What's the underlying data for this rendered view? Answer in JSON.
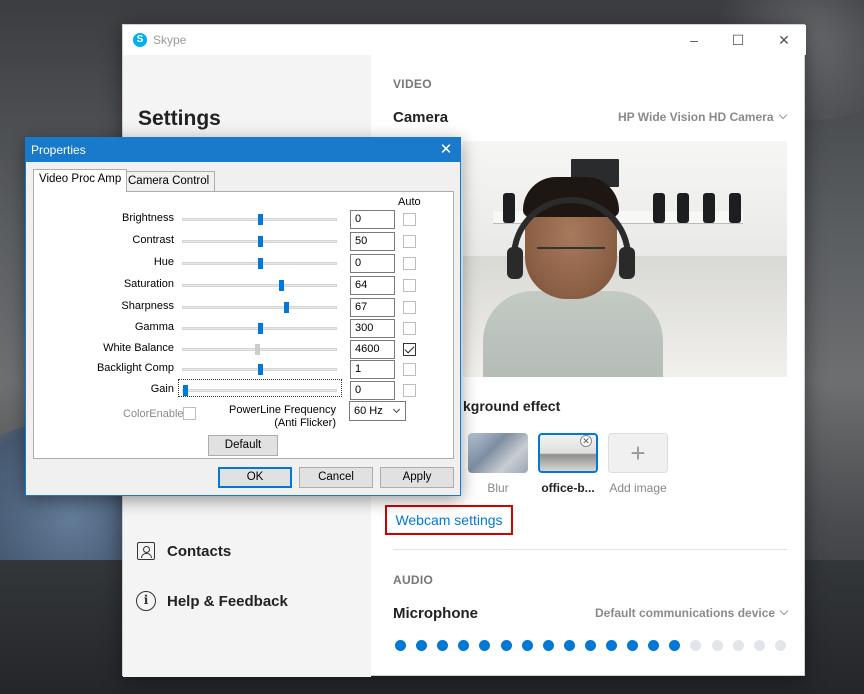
{
  "skype": {
    "title": "Skype",
    "settings_title": "Settings",
    "nav": [
      {
        "label": "Contacts",
        "icon": "contacts-icon"
      },
      {
        "label": "Help & Feedback",
        "icon": "help-icon"
      }
    ],
    "video": {
      "section_label": "VIDEO",
      "camera_label": "Camera",
      "camera_value": "HP Wide Vision HD Camera",
      "background_effect_label": "kground effect",
      "thumbnails": [
        {
          "caption": "Blur",
          "selected": false
        },
        {
          "caption": "office-b...",
          "selected": true
        },
        {
          "caption": "Add image",
          "selected": false
        }
      ],
      "webcam_settings_label": "Webcam settings"
    },
    "audio": {
      "section_label": "AUDIO",
      "microphone_label": "Microphone",
      "microphone_value": "Default communications device",
      "level_total": 19,
      "level_active": 14
    },
    "colors": {
      "accent": "#0078d4",
      "highlight_box": "#d40000",
      "dot_active": "#0078d4",
      "dot_inactive": "#e2e6ea"
    }
  },
  "properties": {
    "title": "Properties",
    "tabs": [
      "Video Proc Amp",
      "Camera Control"
    ],
    "auto_header": "Auto",
    "rows": [
      {
        "label": "Brightness",
        "value": "0",
        "level": 0.5,
        "auto": false,
        "enabled": true
      },
      {
        "label": "Contrast",
        "value": "50",
        "level": 0.5,
        "auto": false,
        "enabled": true
      },
      {
        "label": "Hue",
        "value": "0",
        "level": 0.5,
        "auto": false,
        "enabled": true
      },
      {
        "label": "Saturation",
        "value": "64",
        "level": 0.64,
        "auto": false,
        "enabled": true
      },
      {
        "label": "Sharpness",
        "value": "67",
        "level": 0.67,
        "auto": false,
        "enabled": true
      },
      {
        "label": "Gamma",
        "value": "300",
        "level": 0.5,
        "auto": false,
        "enabled": true
      },
      {
        "label": "White Balance",
        "value": "4600",
        "level": 0.48,
        "auto": true,
        "enabled": false
      },
      {
        "label": "Backlight Comp",
        "value": "1",
        "level": 0.5,
        "auto": false,
        "enabled": true
      },
      {
        "label": "Gain",
        "value": "0",
        "level": 0.0,
        "auto": false,
        "enabled": true
      }
    ],
    "color_enable_label": "ColorEnable",
    "powerline_label_1": "PowerLine Frequency",
    "powerline_label_2": "(Anti Flicker)",
    "powerline_value": "60 Hz",
    "default_button": "Default",
    "ok_button": "OK",
    "cancel_button": "Cancel",
    "apply_button": "Apply",
    "close_glyph": "✕"
  }
}
